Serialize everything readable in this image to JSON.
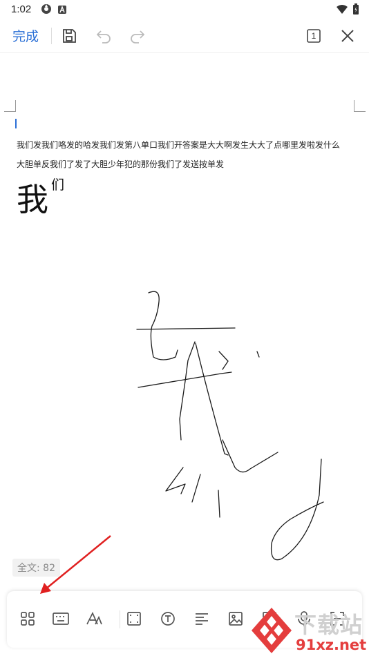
{
  "status_bar": {
    "time": "1:02"
  },
  "toolbar": {
    "done_label": "完成",
    "page_number": "1"
  },
  "document": {
    "paragraph_1": "我们发我们咯发的哈发我们发第八单口我们开答案是大大啊发生大大了点哪里发啦发什么",
    "paragraph_2": "大胆单反我们了发了大胆少年犯的那份我们了发送按单发",
    "large_char": "我",
    "superscript_char": "们"
  },
  "word_count": "全文: 82",
  "watermark": {
    "top_text": "下载站",
    "bottom_text": "91xz.net"
  },
  "colors": {
    "accent": "#2a6fd6",
    "arrow": "#e02020",
    "icon": "#555555"
  }
}
